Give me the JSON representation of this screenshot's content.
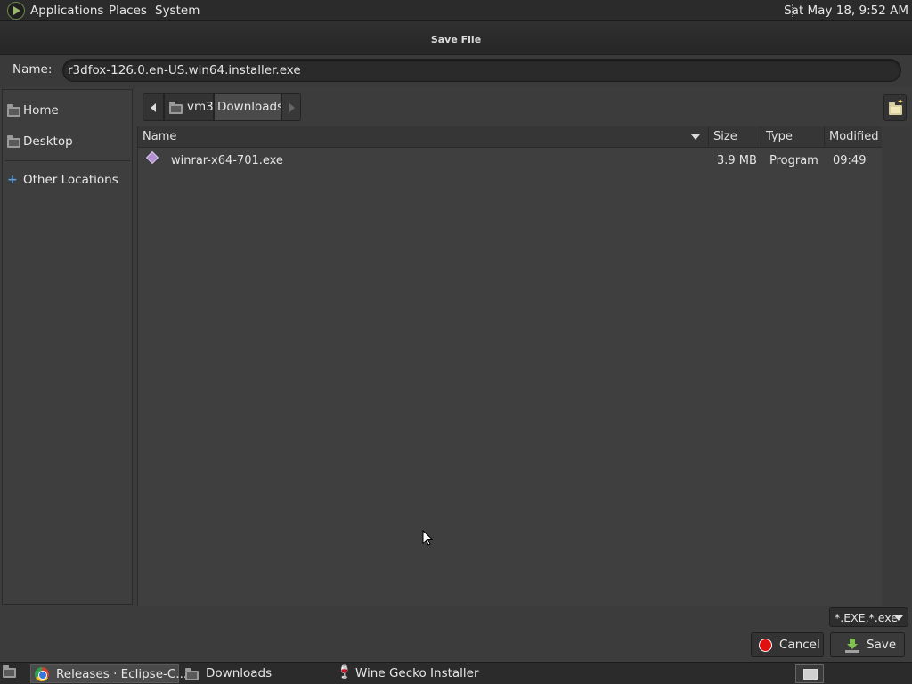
{
  "top_panel": {
    "menus": [
      "Applications",
      "Places",
      "System"
    ],
    "clock": "Sat May 18,  9:52 AM"
  },
  "dialog": {
    "title": "Save File",
    "name_label": "Name:",
    "name_value": "r3dfox-126.0.en-US.win64.installer.exe",
    "sidebar": [
      {
        "label": "Home",
        "icon": "home-folder-icon"
      },
      {
        "label": "Desktop",
        "icon": "desktop-folder-icon"
      },
      {
        "label": "Other Locations",
        "icon": "plus-icon"
      }
    ],
    "path": [
      "vm3",
      "Downloads"
    ],
    "columns": {
      "name": "Name",
      "size": "Size",
      "type": "Type",
      "modified": "Modified"
    },
    "files": [
      {
        "name": "winrar-x64-701.exe",
        "size": "3.9 MB",
        "type": "Program",
        "modified": "09:49"
      }
    ],
    "filter": "*.EXE,*.exe",
    "cancel_label": "Cancel",
    "save_label": "Save"
  },
  "taskbar": {
    "tasks": [
      {
        "label": "Releases · Eclipse-C...",
        "icon": "chrome-icon",
        "active": true
      },
      {
        "label": "Downloads",
        "icon": "folder-icon",
        "active": false
      },
      {
        "label": "Wine Gecko Installer",
        "icon": "wine-icon",
        "active": false
      }
    ]
  },
  "colors": {
    "panel_bg": "#2b2b2b",
    "dialog_bg": "#3c3c3c",
    "accent_cancel": "#e01010",
    "accent_save": "#7fc050"
  }
}
